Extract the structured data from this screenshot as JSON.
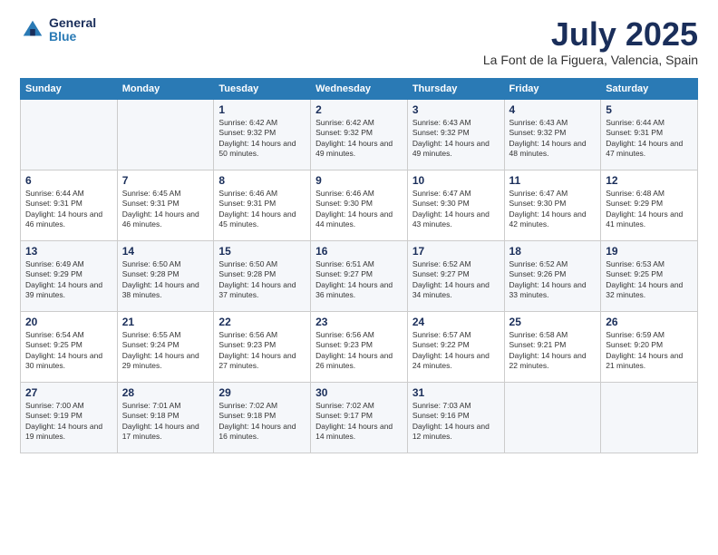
{
  "logo": {
    "general": "General",
    "blue": "Blue"
  },
  "header": {
    "month": "July 2025",
    "location": "La Font de la Figuera, Valencia, Spain"
  },
  "weekdays": [
    "Sunday",
    "Monday",
    "Tuesday",
    "Wednesday",
    "Thursday",
    "Friday",
    "Saturday"
  ],
  "weeks": [
    [
      {
        "day": "",
        "sunrise": "",
        "sunset": "",
        "daylight": ""
      },
      {
        "day": "",
        "sunrise": "",
        "sunset": "",
        "daylight": ""
      },
      {
        "day": "1",
        "sunrise": "Sunrise: 6:42 AM",
        "sunset": "Sunset: 9:32 PM",
        "daylight": "Daylight: 14 hours and 50 minutes."
      },
      {
        "day": "2",
        "sunrise": "Sunrise: 6:42 AM",
        "sunset": "Sunset: 9:32 PM",
        "daylight": "Daylight: 14 hours and 49 minutes."
      },
      {
        "day": "3",
        "sunrise": "Sunrise: 6:43 AM",
        "sunset": "Sunset: 9:32 PM",
        "daylight": "Daylight: 14 hours and 49 minutes."
      },
      {
        "day": "4",
        "sunrise": "Sunrise: 6:43 AM",
        "sunset": "Sunset: 9:32 PM",
        "daylight": "Daylight: 14 hours and 48 minutes."
      },
      {
        "day": "5",
        "sunrise": "Sunrise: 6:44 AM",
        "sunset": "Sunset: 9:31 PM",
        "daylight": "Daylight: 14 hours and 47 minutes."
      }
    ],
    [
      {
        "day": "6",
        "sunrise": "Sunrise: 6:44 AM",
        "sunset": "Sunset: 9:31 PM",
        "daylight": "Daylight: 14 hours and 46 minutes."
      },
      {
        "day": "7",
        "sunrise": "Sunrise: 6:45 AM",
        "sunset": "Sunset: 9:31 PM",
        "daylight": "Daylight: 14 hours and 46 minutes."
      },
      {
        "day": "8",
        "sunrise": "Sunrise: 6:46 AM",
        "sunset": "Sunset: 9:31 PM",
        "daylight": "Daylight: 14 hours and 45 minutes."
      },
      {
        "day": "9",
        "sunrise": "Sunrise: 6:46 AM",
        "sunset": "Sunset: 9:30 PM",
        "daylight": "Daylight: 14 hours and 44 minutes."
      },
      {
        "day": "10",
        "sunrise": "Sunrise: 6:47 AM",
        "sunset": "Sunset: 9:30 PM",
        "daylight": "Daylight: 14 hours and 43 minutes."
      },
      {
        "day": "11",
        "sunrise": "Sunrise: 6:47 AM",
        "sunset": "Sunset: 9:30 PM",
        "daylight": "Daylight: 14 hours and 42 minutes."
      },
      {
        "day": "12",
        "sunrise": "Sunrise: 6:48 AM",
        "sunset": "Sunset: 9:29 PM",
        "daylight": "Daylight: 14 hours and 41 minutes."
      }
    ],
    [
      {
        "day": "13",
        "sunrise": "Sunrise: 6:49 AM",
        "sunset": "Sunset: 9:29 PM",
        "daylight": "Daylight: 14 hours and 39 minutes."
      },
      {
        "day": "14",
        "sunrise": "Sunrise: 6:50 AM",
        "sunset": "Sunset: 9:28 PM",
        "daylight": "Daylight: 14 hours and 38 minutes."
      },
      {
        "day": "15",
        "sunrise": "Sunrise: 6:50 AM",
        "sunset": "Sunset: 9:28 PM",
        "daylight": "Daylight: 14 hours and 37 minutes."
      },
      {
        "day": "16",
        "sunrise": "Sunrise: 6:51 AM",
        "sunset": "Sunset: 9:27 PM",
        "daylight": "Daylight: 14 hours and 36 minutes."
      },
      {
        "day": "17",
        "sunrise": "Sunrise: 6:52 AM",
        "sunset": "Sunset: 9:27 PM",
        "daylight": "Daylight: 14 hours and 34 minutes."
      },
      {
        "day": "18",
        "sunrise": "Sunrise: 6:52 AM",
        "sunset": "Sunset: 9:26 PM",
        "daylight": "Daylight: 14 hours and 33 minutes."
      },
      {
        "day": "19",
        "sunrise": "Sunrise: 6:53 AM",
        "sunset": "Sunset: 9:25 PM",
        "daylight": "Daylight: 14 hours and 32 minutes."
      }
    ],
    [
      {
        "day": "20",
        "sunrise": "Sunrise: 6:54 AM",
        "sunset": "Sunset: 9:25 PM",
        "daylight": "Daylight: 14 hours and 30 minutes."
      },
      {
        "day": "21",
        "sunrise": "Sunrise: 6:55 AM",
        "sunset": "Sunset: 9:24 PM",
        "daylight": "Daylight: 14 hours and 29 minutes."
      },
      {
        "day": "22",
        "sunrise": "Sunrise: 6:56 AM",
        "sunset": "Sunset: 9:23 PM",
        "daylight": "Daylight: 14 hours and 27 minutes."
      },
      {
        "day": "23",
        "sunrise": "Sunrise: 6:56 AM",
        "sunset": "Sunset: 9:23 PM",
        "daylight": "Daylight: 14 hours and 26 minutes."
      },
      {
        "day": "24",
        "sunrise": "Sunrise: 6:57 AM",
        "sunset": "Sunset: 9:22 PM",
        "daylight": "Daylight: 14 hours and 24 minutes."
      },
      {
        "day": "25",
        "sunrise": "Sunrise: 6:58 AM",
        "sunset": "Sunset: 9:21 PM",
        "daylight": "Daylight: 14 hours and 22 minutes."
      },
      {
        "day": "26",
        "sunrise": "Sunrise: 6:59 AM",
        "sunset": "Sunset: 9:20 PM",
        "daylight": "Daylight: 14 hours and 21 minutes."
      }
    ],
    [
      {
        "day": "27",
        "sunrise": "Sunrise: 7:00 AM",
        "sunset": "Sunset: 9:19 PM",
        "daylight": "Daylight: 14 hours and 19 minutes."
      },
      {
        "day": "28",
        "sunrise": "Sunrise: 7:01 AM",
        "sunset": "Sunset: 9:18 PM",
        "daylight": "Daylight: 14 hours and 17 minutes."
      },
      {
        "day": "29",
        "sunrise": "Sunrise: 7:02 AM",
        "sunset": "Sunset: 9:18 PM",
        "daylight": "Daylight: 14 hours and 16 minutes."
      },
      {
        "day": "30",
        "sunrise": "Sunrise: 7:02 AM",
        "sunset": "Sunset: 9:17 PM",
        "daylight": "Daylight: 14 hours and 14 minutes."
      },
      {
        "day": "31",
        "sunrise": "Sunrise: 7:03 AM",
        "sunset": "Sunset: 9:16 PM",
        "daylight": "Daylight: 14 hours and 12 minutes."
      },
      {
        "day": "",
        "sunrise": "",
        "sunset": "",
        "daylight": ""
      },
      {
        "day": "",
        "sunrise": "",
        "sunset": "",
        "daylight": ""
      }
    ]
  ]
}
